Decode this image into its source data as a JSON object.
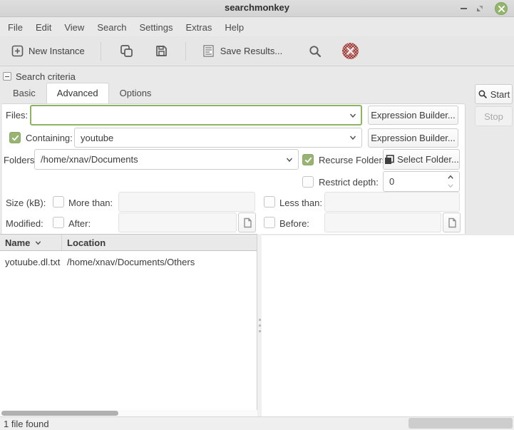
{
  "window": {
    "title": "searchmonkey"
  },
  "menu": {
    "items": [
      "File",
      "Edit",
      "View",
      "Search",
      "Settings",
      "Extras",
      "Help"
    ]
  },
  "toolbar": {
    "new_instance_label": "New Instance",
    "save_results_label": "Save Results..."
  },
  "criteria": {
    "section_title": "Search criteria",
    "tabs": [
      {
        "label": "Basic",
        "active": false
      },
      {
        "label": "Advanced",
        "active": true
      },
      {
        "label": "Options",
        "active": false
      }
    ],
    "files": {
      "label": "Files:",
      "value": "",
      "expression_builder_label": "Expression Builder..."
    },
    "containing": {
      "label": "Containing:",
      "value": "youtube",
      "checked": true,
      "expression_builder_label": "Expression Builder..."
    },
    "folders": {
      "label": "Folders:",
      "value": "/home/xnav/Documents",
      "recurse_label": "Recurse Folders",
      "recurse_checked": true,
      "select_folder_label": "Select Folder..."
    },
    "restrict_depth": {
      "label": "Restrict depth:",
      "checked": false,
      "value": "0"
    },
    "size": {
      "label": "Size (kB):",
      "more_label": "More than:",
      "more_checked": false,
      "more_value": "",
      "less_label": "Less than:",
      "less_checked": false,
      "less_value": ""
    },
    "modified": {
      "label": "Modified:",
      "after_label": "After:",
      "after_checked": false,
      "after_value": "",
      "before_label": "Before:",
      "before_checked": false,
      "before_value": ""
    },
    "start_label": "Start",
    "stop_label": "Stop"
  },
  "results": {
    "columns": [
      "Name",
      "Location"
    ],
    "rows": [
      {
        "name": "yotuube.dl.txt",
        "location": "/home/xnav/Documents/Others"
      }
    ]
  },
  "statusbar": {
    "text": "1 file found"
  },
  "colors": {
    "accent_green": "#97b475",
    "focus_green": "#8cb461",
    "close_button_green": "#94b56e",
    "stop_red": "#9d3a3a"
  }
}
